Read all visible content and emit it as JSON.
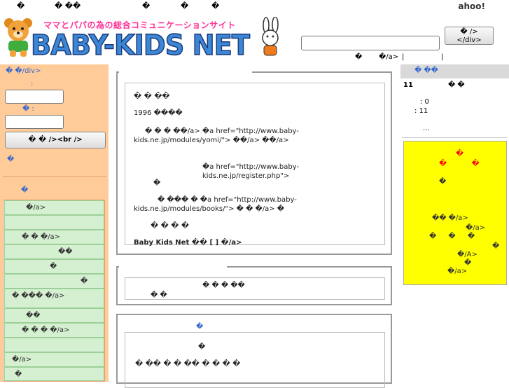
{
  "topbar": {
    "glyphs": [
      "�",
      "� ��",
      "�",
      "�",
      "�"
    ],
    "right_text": "ahoo!"
  },
  "header": {
    "tagline": "ママとパパの為の総合コミュニケーションサイト",
    "brand": "BABY-KIDS NET",
    "search_button_label": "� />\n</div>",
    "search_sub": [
      "�",
      "�/a>",
      "|",
      "|"
    ]
  },
  "login": {
    "title": "� �/div>",
    "id_label": ":",
    "pw_label": "� :",
    "submit_label": "� � /><br />",
    "mark": "�"
  },
  "menu": {
    "title": "�",
    "items": [
      "�/a>",
      "",
      "� � �/a>",
      "��",
      "�",
      "�",
      "� ��� �/a>",
      "��",
      "� � � �/a>",
      "",
      "�/a>",
      "�"
    ]
  },
  "main_panel": {
    "lines": [
      "�                     � ��",
      "1996                       ����",
      "� � � ��/a> �a href=\"http://www.baby-",
      "kids.ne.jp/modules/yomi/\">         ��/a>          ��/a>",
      "�a href=\"http://www.baby-kids.ne.jp/register.php\">",
      "�",
      "� ��� � �a href=\"http://www.baby-",
      "kids.ne.jp/modules/books/\">     � � �/a>  �",
      "�                   � � �",
      "Baby Kids Net  ��    [            ]           �/a>"
    ]
  },
  "news_panel": {
    "line1": "� � � ��",
    "line2": "� �"
  },
  "lower_panel": {
    "mark": "�",
    "line1": "�",
    "line2": "� ��  �        � ��      �                   �       � �"
  },
  "sidebar_right": {
    "header": "� ��",
    "stat_title": "11",
    "stat_marks": "� �",
    "stat_a": ": 0",
    "stat_b": ": 11",
    "more": "...",
    "ad_lines": [
      "�",
      "� �",
      "�",
      "��  �/a>",
      "�/a>",
      "� � �",
      "�",
      "�/A>",
      "�",
      "�/a>"
    ]
  },
  "colors": {
    "left_bg": "#ffcc99",
    "menu_item_bg": "#d4f0d0",
    "ad_bg": "#ffff00",
    "link_blue": "#3366cc",
    "tagline_pink": "#ff3399"
  }
}
